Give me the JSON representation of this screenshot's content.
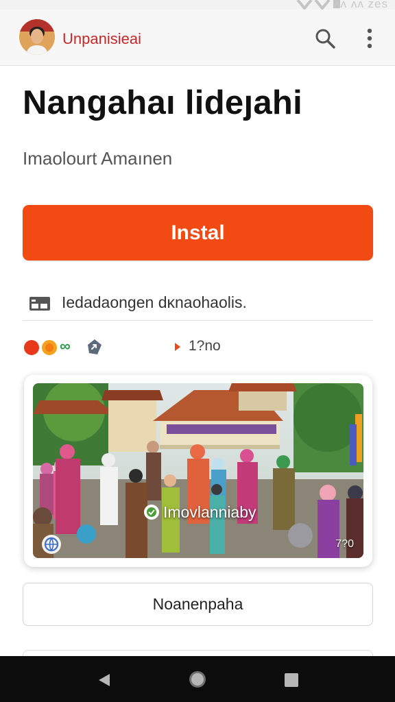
{
  "status_bar": {
    "text": "ᴧᴧ ᴧᴧ zes"
  },
  "app_bar": {
    "brand": "Unpanisieai",
    "icons": {
      "search": "search-icon",
      "more": "more-vert-icon",
      "avatar": "avatar-photo"
    }
  },
  "page": {
    "title": "Nangahaı lideȷahi",
    "subtitle": "Imaolourt Amaınen",
    "install_label": "Instal",
    "info_text": "Iedadaongen dĸnaohaolis.",
    "meta": {
      "count": "1?no"
    },
    "media": {
      "badge_label": "Imovlanniaby",
      "duration": "7?0"
    },
    "secondary_button_label": "Noanenpaha"
  },
  "colors": {
    "accent": "#f14a12",
    "brand_text": "#c62828",
    "nav_bar": "#0c0c0c"
  }
}
